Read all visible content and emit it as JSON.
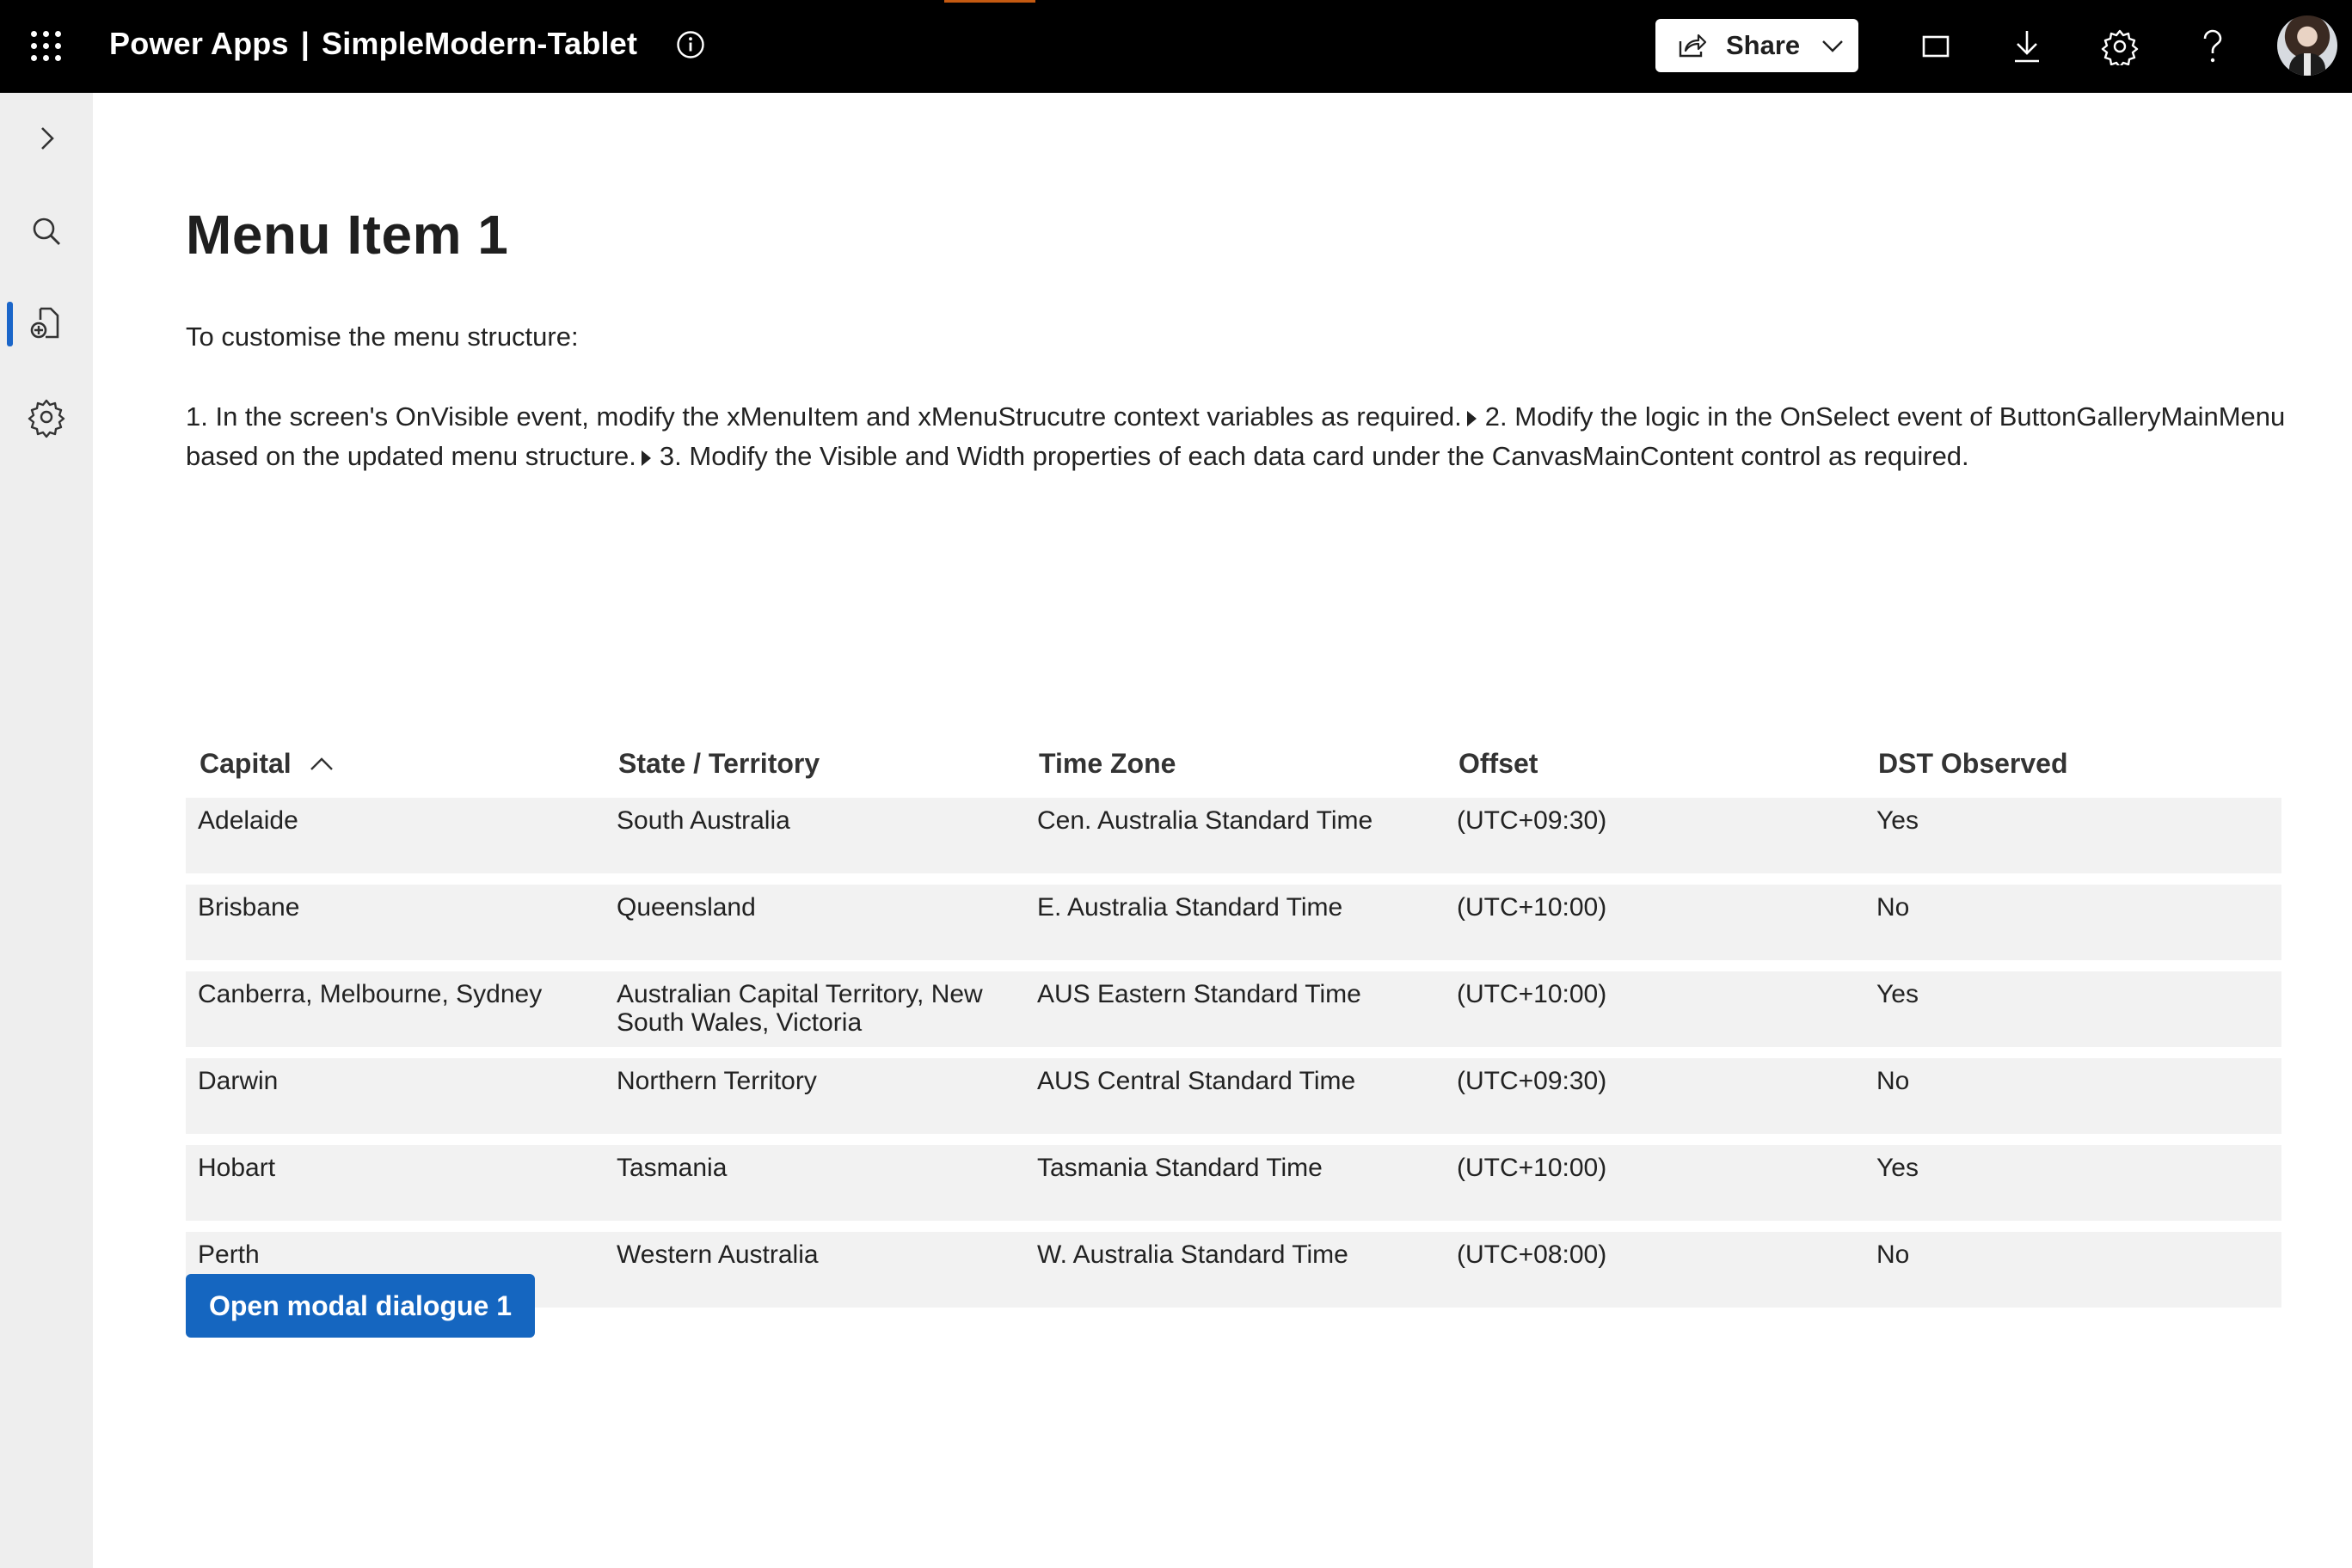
{
  "header": {
    "app_name": "Power Apps",
    "separator": "|",
    "app_file": "SimpleModern-Tablet",
    "share_label": "Share",
    "icons": [
      "waffle-icon",
      "info-icon",
      "share-icon",
      "chevron-down-icon",
      "fit-to-window-icon",
      "download-icon",
      "settings-icon",
      "help-icon"
    ],
    "accent_color": "#c55a11"
  },
  "rail": {
    "items": [
      "expand",
      "search",
      "add-document",
      "settings"
    ],
    "active_color": "#1b66c9"
  },
  "main": {
    "title": "Menu Item 1",
    "intro": "To customise the menu structure:",
    "steps": [
      "1. In the screen's OnVisible event, modify the xMenuItem and xMenuStrucutre context variables as required.",
      "2. Modify the logic in the OnSelect event of ButtonGalleryMainMenu based on the updated menu structure.",
      "3. Modify the Visible and Width properties of each data card under the CanvasMainContent control as required."
    ]
  },
  "table": {
    "columns": [
      "Capital",
      "State / Territory",
      "Time Zone",
      "Offset",
      "DST Observed"
    ],
    "sorted_column": "Capital",
    "sort_direction": "ascending",
    "rows": [
      [
        "Adelaide",
        "South Australia",
        "Cen. Australia Standard Time",
        "(UTC+09:30)",
        "Yes"
      ],
      [
        "Brisbane",
        "Queensland",
        "E. Australia Standard Time",
        "(UTC+10:00)",
        "No"
      ],
      [
        "Canberra, Melbourne, Sydney",
        "Australian Capital Territory, New South Wales, Victoria",
        "AUS Eastern Standard Time",
        "(UTC+10:00)",
        "Yes"
      ],
      [
        "Darwin",
        "Northern Territory",
        "AUS Central Standard Time",
        "(UTC+09:30)",
        "No"
      ],
      [
        "Hobart",
        "Tasmania",
        "Tasmania Standard Time",
        "(UTC+10:00)",
        "Yes"
      ],
      [
        "Perth",
        "Western Australia",
        "W. Australia Standard Time",
        "(UTC+08:00)",
        "No"
      ]
    ]
  },
  "actions": {
    "open_modal_label": "Open modal dialogue 1",
    "button_color": "#1566c0"
  }
}
